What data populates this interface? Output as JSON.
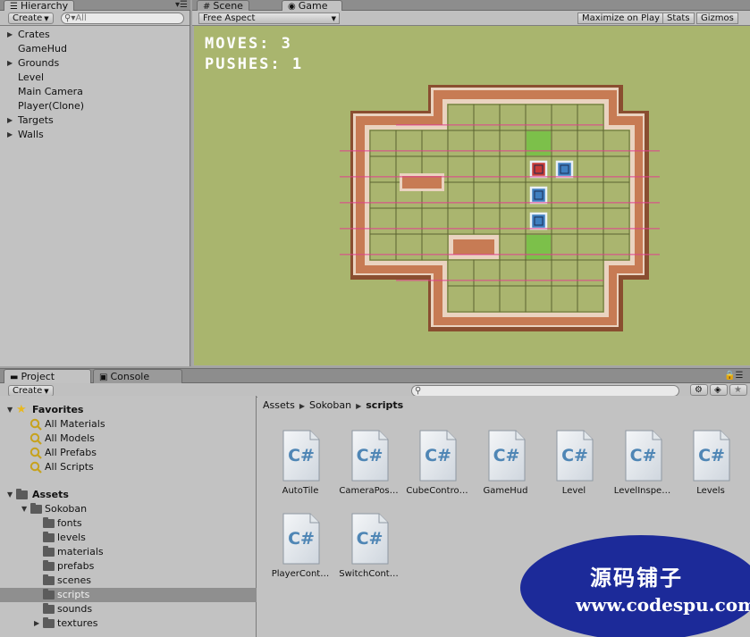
{
  "hierarchy": {
    "tab_label": "Hierarchy",
    "create_label": "Create",
    "search_placeholder": "All",
    "items": [
      {
        "label": "Crates",
        "expandable": true
      },
      {
        "label": "GameHud",
        "expandable": false
      },
      {
        "label": "Grounds",
        "expandable": true
      },
      {
        "label": "Level",
        "expandable": false
      },
      {
        "label": "Main Camera",
        "expandable": false
      },
      {
        "label": "Player(Clone)",
        "expandable": false
      },
      {
        "label": "Targets",
        "expandable": true
      },
      {
        "label": "Walls",
        "expandable": true
      }
    ]
  },
  "view_tabs": {
    "scene_label": "Scene",
    "game_label": "Game"
  },
  "game_toolbar": {
    "aspect_label": "Free Aspect",
    "maximize_label": "Maximize on Play",
    "stats_label": "Stats",
    "gizmos_label": "Gizmos"
  },
  "game_hud": {
    "moves_text": "MOVES: 3",
    "pushes_text": "PUSHES: 1"
  },
  "project": {
    "tab_label": "Project",
    "console_label": "Console",
    "create_label": "Create",
    "favorites_label": "Favorites",
    "favorites": [
      "All Materials",
      "All Models",
      "All Prefabs",
      "All Scripts"
    ],
    "assets_label": "Assets",
    "sokoban_label": "Sokoban",
    "folders": [
      "fonts",
      "levels",
      "materials",
      "prefabs",
      "scenes",
      "scripts",
      "sounds",
      "textures"
    ],
    "selected_folder": "scripts",
    "breadcrumb": [
      "Assets",
      "Sokoban",
      "scripts"
    ],
    "script_badge": "C#",
    "files": [
      "AutoTile",
      "CameraPos…",
      "CubeContro…",
      "GameHud",
      "Level",
      "LevelInspe…",
      "Levels",
      "PlayerCont…",
      "SwitchCont…"
    ]
  },
  "watermark": {
    "title": "源码铺子",
    "url": "www.codespu.com"
  },
  "colors": {
    "panel": "#c2c2c2",
    "viewport": "#a9b56e",
    "wall_outer": "#c77b54",
    "wall_highlight": "#ead3c0",
    "wall_shadow": "#8a4e30",
    "target_green": "#7cc04a",
    "crate_blue": "#3f7fc0",
    "crate_red": "#c83b37",
    "gizmo_line": "#e0408f",
    "watermark_blue": "#1c2a99"
  },
  "board": {
    "floor_cells": [
      [
        6,
        1
      ],
      [
        6,
        2
      ],
      [
        6,
        3
      ],
      [
        6,
        4
      ],
      [
        6,
        5
      ],
      [
        6,
        6
      ],
      [
        7,
        1
      ],
      [
        7,
        2
      ],
      [
        7,
        3
      ],
      [
        7,
        4
      ],
      [
        7,
        5
      ],
      [
        7,
        6
      ],
      [
        1,
        3
      ],
      [
        2,
        3
      ],
      [
        3,
        3
      ],
      [
        4,
        3
      ],
      [
        5,
        3
      ],
      [
        8,
        3
      ],
      [
        9,
        3
      ],
      [
        10,
        3
      ],
      [
        1,
        2
      ],
      [
        2,
        2
      ],
      [
        3,
        2
      ],
      [
        4,
        2
      ],
      [
        5,
        2
      ],
      [
        8,
        2
      ],
      [
        9,
        2
      ],
      [
        10,
        2
      ],
      [
        1,
        4
      ],
      [
        2,
        4
      ],
      [
        3,
        4
      ],
      [
        4,
        4
      ],
      [
        5,
        4
      ],
      [
        8,
        4
      ],
      [
        9,
        4
      ],
      [
        10,
        4
      ],
      [
        1,
        5
      ],
      [
        2,
        5
      ],
      [
        3,
        5
      ],
      [
        4,
        5
      ],
      [
        5,
        5
      ],
      [
        8,
        5
      ],
      [
        9,
        5
      ],
      [
        10,
        5
      ],
      [
        1,
        6
      ],
      [
        2,
        6
      ],
      [
        3,
        6
      ],
      [
        8,
        6
      ],
      [
        9,
        6
      ],
      [
        10,
        6
      ],
      [
        4,
        7
      ],
      [
        5,
        7
      ],
      [
        6,
        7
      ],
      [
        7,
        7
      ],
      [
        8,
        7
      ],
      [
        9,
        7
      ],
      [
        4,
        8
      ],
      [
        5,
        8
      ],
      [
        6,
        8
      ],
      [
        7,
        8
      ],
      [
        8,
        8
      ],
      [
        9,
        8
      ],
      [
        4,
        1
      ],
      [
        5,
        1
      ],
      [
        8,
        1
      ],
      [
        9,
        1
      ]
    ],
    "targets": [
      [
        7,
        2
      ],
      [
        7,
        6
      ]
    ],
    "red_crates": [
      [
        7,
        3
      ]
    ],
    "blue_crates": [
      [
        8,
        3
      ],
      [
        7,
        4
      ],
      [
        7,
        5
      ]
    ]
  }
}
